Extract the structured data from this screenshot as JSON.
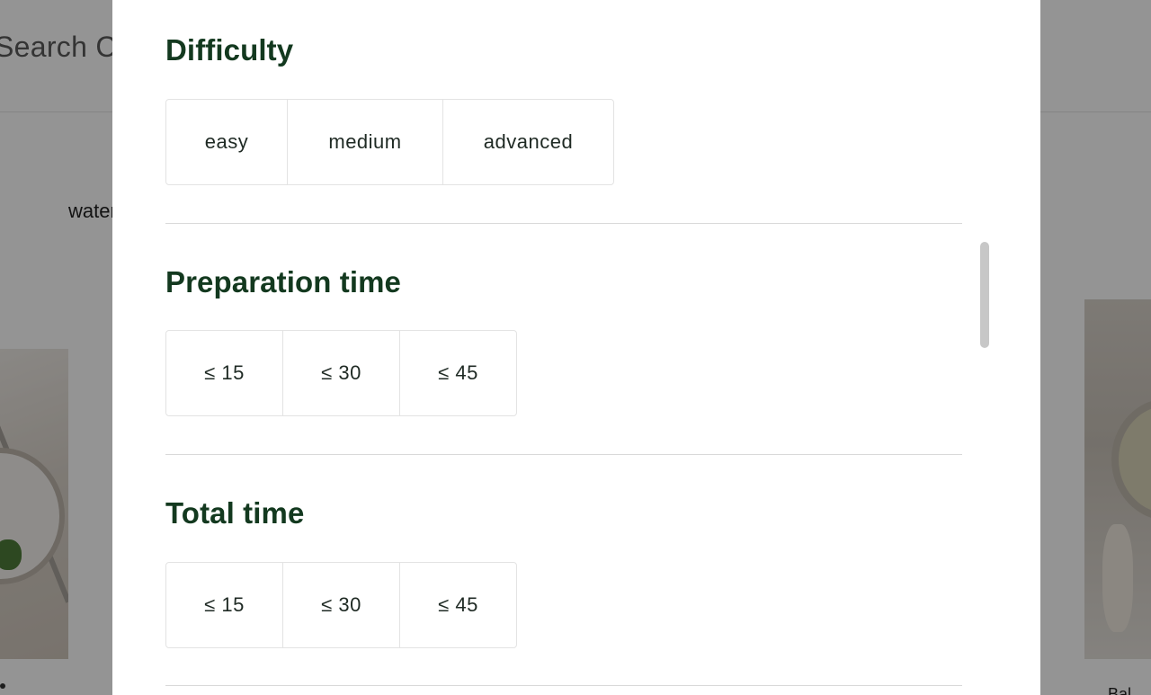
{
  "background": {
    "search_text": "Search Co",
    "chip_text": "water",
    "card_right_caption": "Bal"
  },
  "filters": {
    "difficulty": {
      "title": "Difficulty",
      "options": [
        "easy",
        "medium",
        "advanced"
      ]
    },
    "preparation_time": {
      "title": "Preparation time",
      "options": [
        "≤ 15",
        "≤ 30",
        "≤ 45"
      ]
    },
    "total_time": {
      "title": "Total time",
      "options": [
        "≤ 15",
        "≤ 30",
        "≤ 45"
      ]
    }
  },
  "colors": {
    "heading": "#13391f",
    "option_text": "#1f2a24",
    "border": "#e3e3e3",
    "divider": "#d9d9d9",
    "overlay": "rgba(0,0,0,0.42)"
  }
}
